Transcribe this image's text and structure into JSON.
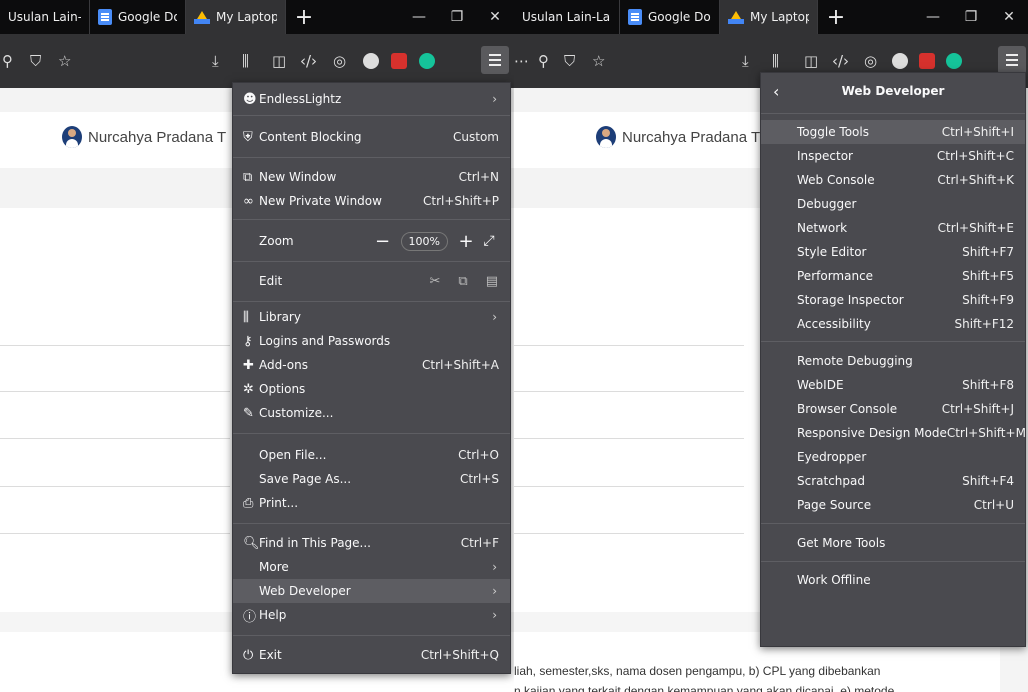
{
  "left_window": {
    "tabs": [
      {
        "title": "Usulan Lain-Lain",
        "icon": "none"
      },
      {
        "title": "Google Dokumen",
        "icon": "google-docs-icon"
      },
      {
        "title": "My Laptop",
        "icon": "google-drive-icon"
      }
    ],
    "author_name": "Nurcahya Pradana T",
    "menu": {
      "profile": "EndlessLightz",
      "content_blocking": {
        "label": "Content Blocking",
        "value": "Custom"
      },
      "new_window": {
        "label": "New Window",
        "shortcut": "Ctrl+N"
      },
      "new_private_window": {
        "label": "New Private Window",
        "shortcut": "Ctrl+Shift+P"
      },
      "zoom": {
        "label": "Zoom",
        "value": "100%"
      },
      "edit_label": "Edit",
      "library": "Library",
      "logins": "Logins and Passwords",
      "addons": {
        "label": "Add-ons",
        "shortcut": "Ctrl+Shift+A"
      },
      "options": "Options",
      "customize": "Customize...",
      "open_file": {
        "label": "Open File...",
        "shortcut": "Ctrl+O"
      },
      "save_page": {
        "label": "Save Page As...",
        "shortcut": "Ctrl+S"
      },
      "print": "Print...",
      "find": {
        "label": "Find in This Page...",
        "shortcut": "Ctrl+F"
      },
      "more": "More",
      "web_developer": "Web Developer",
      "help": "Help",
      "exit": {
        "label": "Exit",
        "shortcut": "Ctrl+Shift+Q"
      }
    }
  },
  "right_window": {
    "tabs": [
      {
        "title": "Usulan Lain-Lain",
        "icon": "none"
      },
      {
        "title": "Google Dokumen",
        "icon": "google-docs-icon"
      },
      {
        "title": "My Laptop",
        "icon": "google-drive-icon"
      }
    ],
    "author_name": "Nurcahya Pradana T",
    "doc_line_1": "liah, semester,sks, nama dosen pengampu, b) CPL yang dibebankan",
    "doc_line_2": "n kajian yang terkait dengan kemampuan yang akan dicapai, e) metode",
    "web_developer_menu": {
      "title": "Web Developer",
      "items": [
        {
          "label": "Toggle Tools",
          "shortcut": "Ctrl+Shift+I"
        },
        {
          "label": "Inspector",
          "shortcut": "Ctrl+Shift+C"
        },
        {
          "label": "Web Console",
          "shortcut": "Ctrl+Shift+K"
        },
        {
          "label": "Debugger",
          "shortcut": ""
        },
        {
          "label": "Network",
          "shortcut": "Ctrl+Shift+E"
        },
        {
          "label": "Style Editor",
          "shortcut": "Shift+F7"
        },
        {
          "label": "Performance",
          "shortcut": "Shift+F5"
        },
        {
          "label": "Storage Inspector",
          "shortcut": "Shift+F9"
        },
        {
          "label": "Accessibility",
          "shortcut": "Shift+F12"
        },
        {
          "label": "Remote Debugging",
          "shortcut": ""
        },
        {
          "label": "WebIDE",
          "shortcut": "Shift+F8"
        },
        {
          "label": "Browser Console",
          "shortcut": "Ctrl+Shift+J"
        },
        {
          "label": "Responsive Design Mode",
          "shortcut": "Ctrl+Shift+M"
        },
        {
          "label": "Eyedropper",
          "shortcut": ""
        },
        {
          "label": "Scratchpad",
          "shortcut": "Shift+F4"
        },
        {
          "label": "Page Source",
          "shortcut": "Ctrl+U"
        },
        {
          "label": "Get More Tools",
          "shortcut": ""
        },
        {
          "label": "Work Offline",
          "shortcut": ""
        }
      ]
    }
  },
  "colors": {
    "tabbar": "#0c0c0d",
    "toolbar": "#323234",
    "menu_bg": "#4a4a4f",
    "menu_highlight": "#5d5d62",
    "text": "#f9f9fa"
  }
}
